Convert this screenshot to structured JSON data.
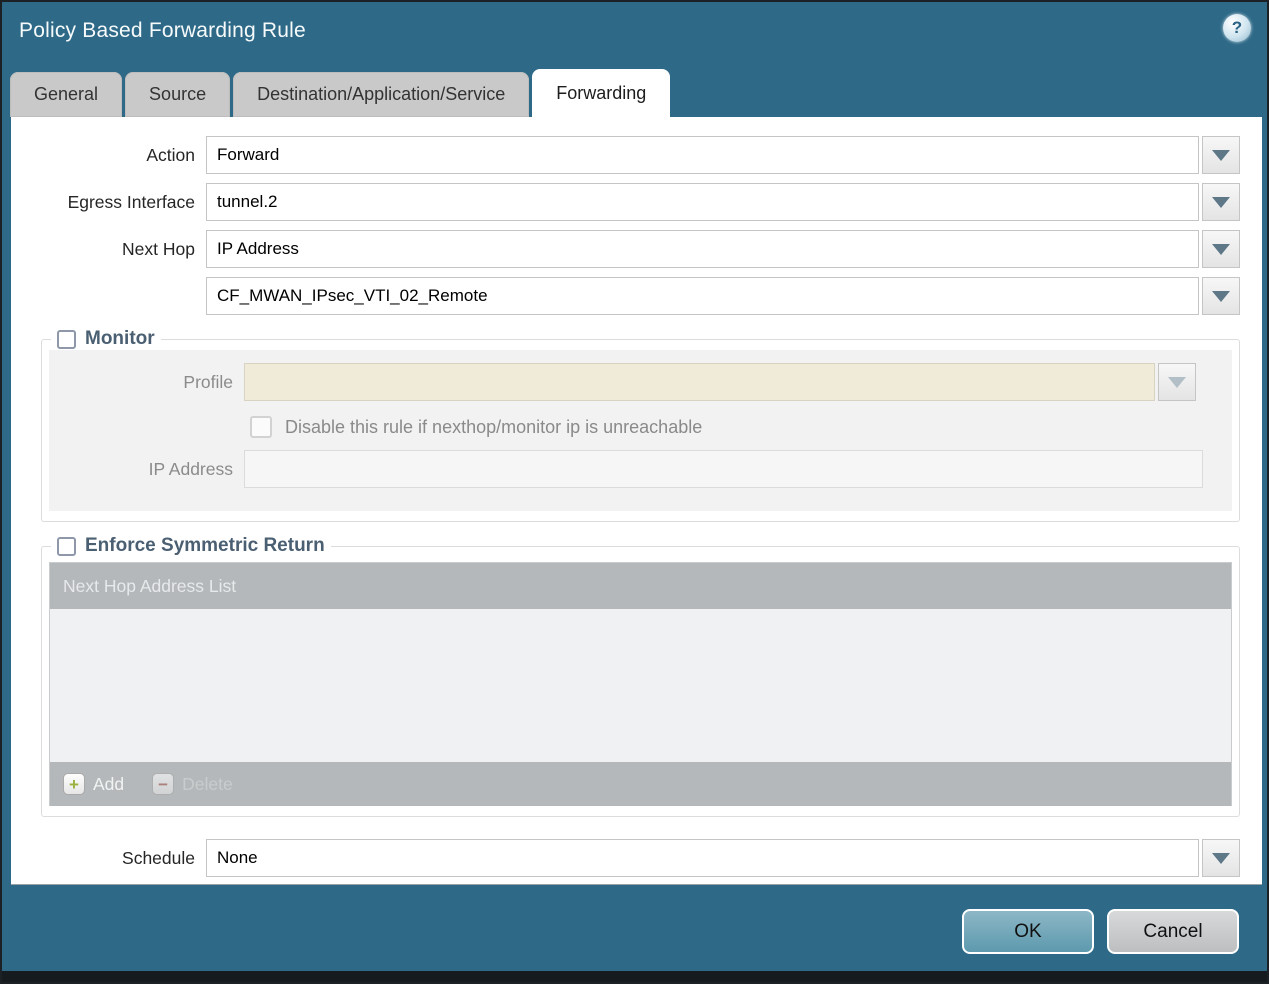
{
  "dialog": {
    "title": "Policy Based Forwarding Rule"
  },
  "icons": {
    "help_glyph": "?",
    "add_glyph": "+",
    "delete_glyph": "−"
  },
  "tabs": [
    {
      "label": "General",
      "active": false
    },
    {
      "label": "Source",
      "active": false
    },
    {
      "label": "Destination/Application/Service",
      "active": false
    },
    {
      "label": "Forwarding",
      "active": true
    }
  ],
  "form": {
    "action": {
      "label": "Action",
      "value": "Forward"
    },
    "egress_interface": {
      "label": "Egress Interface",
      "value": "tunnel.2"
    },
    "next_hop": {
      "label": "Next Hop",
      "value": "IP Address"
    },
    "next_hop_address": {
      "value": "CF_MWAN_IPsec_VTI_02_Remote"
    },
    "schedule": {
      "label": "Schedule",
      "value": "None"
    }
  },
  "monitor": {
    "title": "Monitor",
    "checked": false,
    "profile": {
      "label": "Profile",
      "value": ""
    },
    "disable_rule_label": "Disable this rule if nexthop/monitor ip is unreachable",
    "disable_rule_checked": false,
    "ip_address": {
      "label": "IP Address",
      "value": ""
    }
  },
  "symmetric_return": {
    "title": "Enforce Symmetric Return",
    "checked": false,
    "table_header": "Next Hop Address List",
    "rows": [],
    "add_label": "Add",
    "delete_label": "Delete",
    "delete_enabled": false
  },
  "footer": {
    "ok_label": "OK",
    "cancel_label": "Cancel"
  },
  "colors": {
    "titlebar_teal": "#2e6a88",
    "active_tab": "#ffffff",
    "inactive_tab": "#c9c9c9",
    "section_title": "#4a5f72",
    "section_bg": "#f2f2f2",
    "disabled_profile_bg": "#f0ead8",
    "table_bar": "#b4b8ba",
    "add_icon_green": "#9ab13b",
    "delete_icon_red": "#a85c55",
    "ok_button": "#6ba3b6",
    "cancel_button": "#c3c5c7",
    "dropdown_arrow": "#5e7888"
  }
}
